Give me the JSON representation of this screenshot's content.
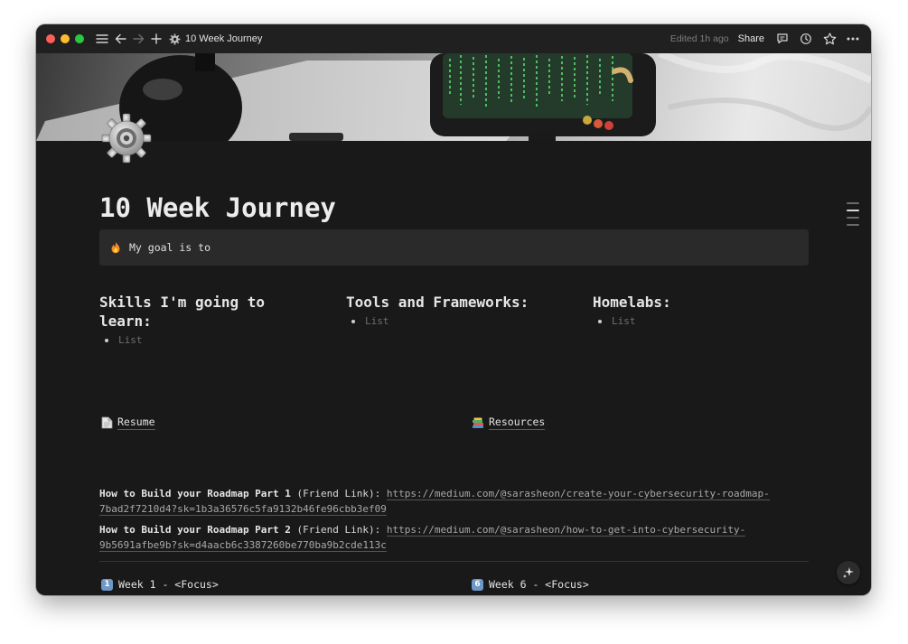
{
  "titlebar": {
    "page_title": "10 Week Journey",
    "edited": "Edited 1h ago",
    "share_label": "Share"
  },
  "page": {
    "title": "10 Week Journey",
    "callout_text": "My goal is to",
    "callout_emoji": "fire-icon"
  },
  "columns": [
    {
      "heading": "Skills I'm going to learn:",
      "item_placeholder": "List"
    },
    {
      "heading": "Tools and Frameworks:",
      "item_placeholder": "List"
    },
    {
      "heading": "Homelabs:",
      "item_placeholder": "List"
    }
  ],
  "links": {
    "resume": "Resume",
    "resources": "Resources"
  },
  "roadmap": [
    {
      "bold": "How to Build your Roadmap Part 1",
      "paren": "(Friend Link):",
      "url": "https://medium.com/@sarasheon/create-your-cybersecurity-roadmap-7bad2f7210d4?sk=1b3a36576c5fa9132b46fe96cbb3ef09"
    },
    {
      "bold": "How to Build your Roadmap Part 2",
      "paren": "(Friend Link):",
      "url": "https://medium.com/@sarasheon/how-to-get-into-cybersecurity-9b5691afbe9b?sk=d4aacb6c3387260be770ba9b2cde113c"
    }
  ],
  "weeks": [
    {
      "num": "1",
      "label": "Week 1 - <Focus>"
    },
    {
      "num": "6",
      "label": "Week 6 - <Focus>"
    }
  ],
  "colors": {
    "background": "#191919",
    "titlebar": "#202020",
    "callout": "#2a2a2a",
    "text": "#e3e3e3",
    "week_badge": "#6f97c7"
  }
}
